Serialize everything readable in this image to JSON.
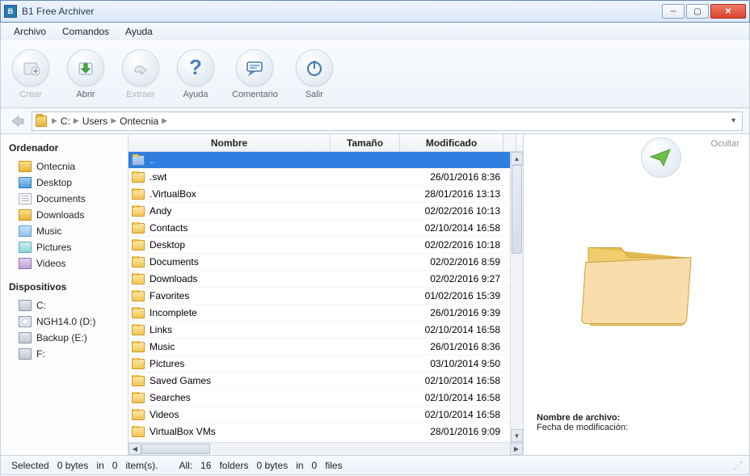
{
  "window": {
    "title": "B1 Free Archiver"
  },
  "menu": {
    "file": "Archivo",
    "commands": "Comandos",
    "help": "Ayuda"
  },
  "toolbar": {
    "create": "Crear",
    "open": "Abrir",
    "extract": "Extraer",
    "help": "Ayuda",
    "comment": "Comentario",
    "exit": "Salir"
  },
  "breadcrumb": {
    "drive": "C:",
    "seg1": "Users",
    "seg2": "Ontecnia"
  },
  "sidebar": {
    "computer_head": "Ordenador",
    "items": [
      {
        "label": "Ontecnia",
        "icon": "ic-folder"
      },
      {
        "label": "Desktop",
        "icon": "ic-desktop"
      },
      {
        "label": "Documents",
        "icon": "ic-doc"
      },
      {
        "label": "Downloads",
        "icon": "ic-folder"
      },
      {
        "label": "Music",
        "icon": "ic-music"
      },
      {
        "label": "Pictures",
        "icon": "ic-pic"
      },
      {
        "label": "Videos",
        "icon": "ic-vid"
      }
    ],
    "devices_head": "Dispositivos",
    "devices": [
      {
        "label": "C:",
        "icon": "ic-drive"
      },
      {
        "label": "NGH14.0 (D:)",
        "icon": "ic-cd"
      },
      {
        "label": "Backup (E:)",
        "icon": "ic-drive"
      },
      {
        "label": "F:",
        "icon": "ic-drive"
      }
    ]
  },
  "cols": {
    "name": "Nombre",
    "size": "Tamaño",
    "mod": "Modificado"
  },
  "rows": [
    {
      "name": "..",
      "size": "",
      "mod": ""
    },
    {
      "name": ".swt",
      "size": "",
      "mod": "26/01/2016 8:36"
    },
    {
      "name": ".VirtualBox",
      "size": "",
      "mod": "28/01/2016 13:13"
    },
    {
      "name": "Andy",
      "size": "",
      "mod": "02/02/2016 10:13"
    },
    {
      "name": "Contacts",
      "size": "",
      "mod": "02/10/2014 16:58"
    },
    {
      "name": "Desktop",
      "size": "",
      "mod": "02/02/2016 10:18"
    },
    {
      "name": "Documents",
      "size": "",
      "mod": "02/02/2016 8:59"
    },
    {
      "name": "Downloads",
      "size": "",
      "mod": "02/02/2016 9:27"
    },
    {
      "name": "Favorites",
      "size": "",
      "mod": "01/02/2016 15:39"
    },
    {
      "name": "Incomplete",
      "size": "",
      "mod": "26/01/2016 9:39"
    },
    {
      "name": "Links",
      "size": "",
      "mod": "02/10/2014 16:58"
    },
    {
      "name": "Music",
      "size": "",
      "mod": "26/01/2016 8:36"
    },
    {
      "name": "Pictures",
      "size": "",
      "mod": "03/10/2014 9:50"
    },
    {
      "name": "Saved Games",
      "size": "",
      "mod": "02/10/2014 16:58"
    },
    {
      "name": "Searches",
      "size": "",
      "mod": "02/10/2014 16:58"
    },
    {
      "name": "Videos",
      "size": "",
      "mod": "02/10/2014 16:58"
    },
    {
      "name": "VirtualBox VMs",
      "size": "",
      "mod": "28/01/2016 9:09"
    }
  ],
  "preview": {
    "hide": "Ocultar",
    "name_label": "Nombre de archivo:",
    "date_label": "Fecha de modificación:"
  },
  "status": {
    "selected": "Selected",
    "bytes0a": "0 bytes",
    "in_a": "in",
    "items": "0",
    "items_lbl": "item(s).",
    "all": "All:",
    "folders": "16",
    "folders_lbl": "folders",
    "bytes0b": "0 bytes",
    "in_b": "in",
    "files": "0",
    "files_lbl": "files"
  }
}
